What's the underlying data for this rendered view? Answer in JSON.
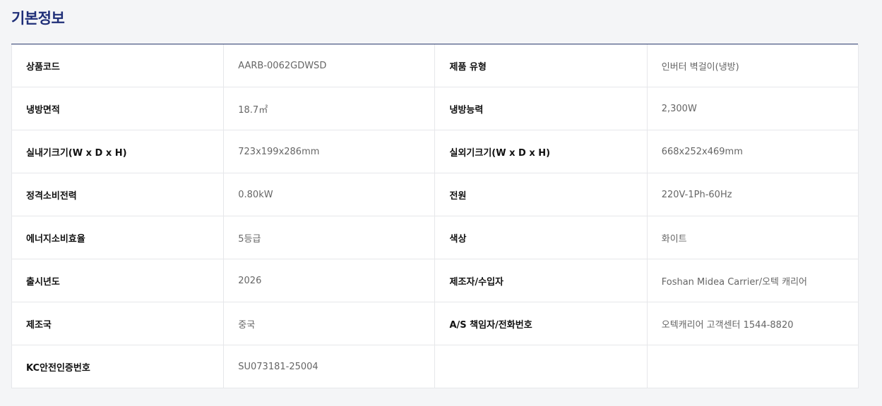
{
  "section": {
    "title": "기본정보"
  },
  "rows": [
    {
      "l1": "상품코드",
      "v1": "AARB-0062GDWSD",
      "l2": "제품 유형",
      "v2": "인버터 벽걸이(냉방)"
    },
    {
      "l1": "냉방면적",
      "v1": "18.7㎡",
      "l2": "냉방능력",
      "v2": "2,300W"
    },
    {
      "l1": "실내기크기(W x D x H)",
      "v1": "723x199x286mm",
      "l2": "실외기크기(W x D x H)",
      "v2": "668x252x469mm"
    },
    {
      "l1": "정격소비전력",
      "v1": "0.80kW",
      "l2": "전원",
      "v2": "220V-1Ph-60Hz"
    },
    {
      "l1": "에너지소비효율",
      "v1": "5등급",
      "l2": "색상",
      "v2": "화이트"
    },
    {
      "l1": "출시년도",
      "v1": "2026",
      "l2": "제조자/수입자",
      "v2": "Foshan Midea Carrier/오텍 캐리어"
    },
    {
      "l1": "제조국",
      "v1": "중국",
      "l2": "A/S 책임자/전화번호",
      "v2": "오텍캐리어 고객센터 1544-8820"
    },
    {
      "l1": "KC안전인증번호",
      "v1": "SU073181-25004",
      "l2": "",
      "v2": ""
    }
  ],
  "colors": {
    "title": "#1f2f78",
    "divider": "#2b3a6e",
    "label_text": "#111111",
    "value_text": "#666666",
    "page_background": "#f4f5f7",
    "cell_background": "#ffffff",
    "cell_border": "#e6e7ea"
  }
}
